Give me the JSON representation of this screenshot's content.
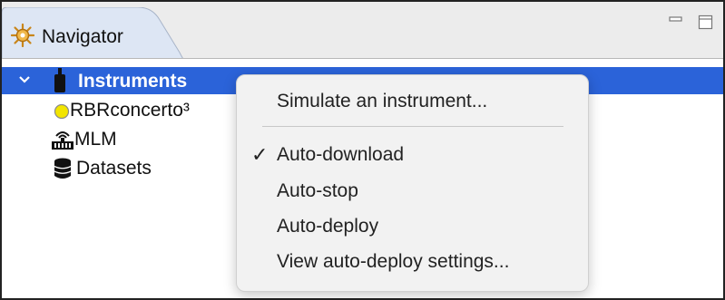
{
  "view": {
    "title": "Navigator",
    "icon": "navigator-icon"
  },
  "tree": {
    "items": [
      {
        "label": "Instruments",
        "icon": "instrument-icon",
        "expanded": true,
        "selected": true
      },
      {
        "label": "RBRconcerto³",
        "icon": "status-circle-icon",
        "status_color": "#f2e500"
      },
      {
        "label": "MLM",
        "icon": "mlm-device-icon"
      },
      {
        "label": "Datasets",
        "icon": "database-icon"
      }
    ]
  },
  "context_menu": {
    "items": [
      {
        "label": "Simulate an instrument...",
        "checked": false
      },
      {
        "label": "Auto-download",
        "checked": true
      },
      {
        "label": "Auto-stop",
        "checked": false
      },
      {
        "label": "Auto-deploy",
        "checked": false
      },
      {
        "label": "View auto-deploy settings...",
        "checked": false
      }
    ],
    "check_glyph": "✓"
  },
  "colors": {
    "selection": "#2b63d9",
    "menu_background": "#f2f2f2",
    "tab_background": "#ececec"
  }
}
